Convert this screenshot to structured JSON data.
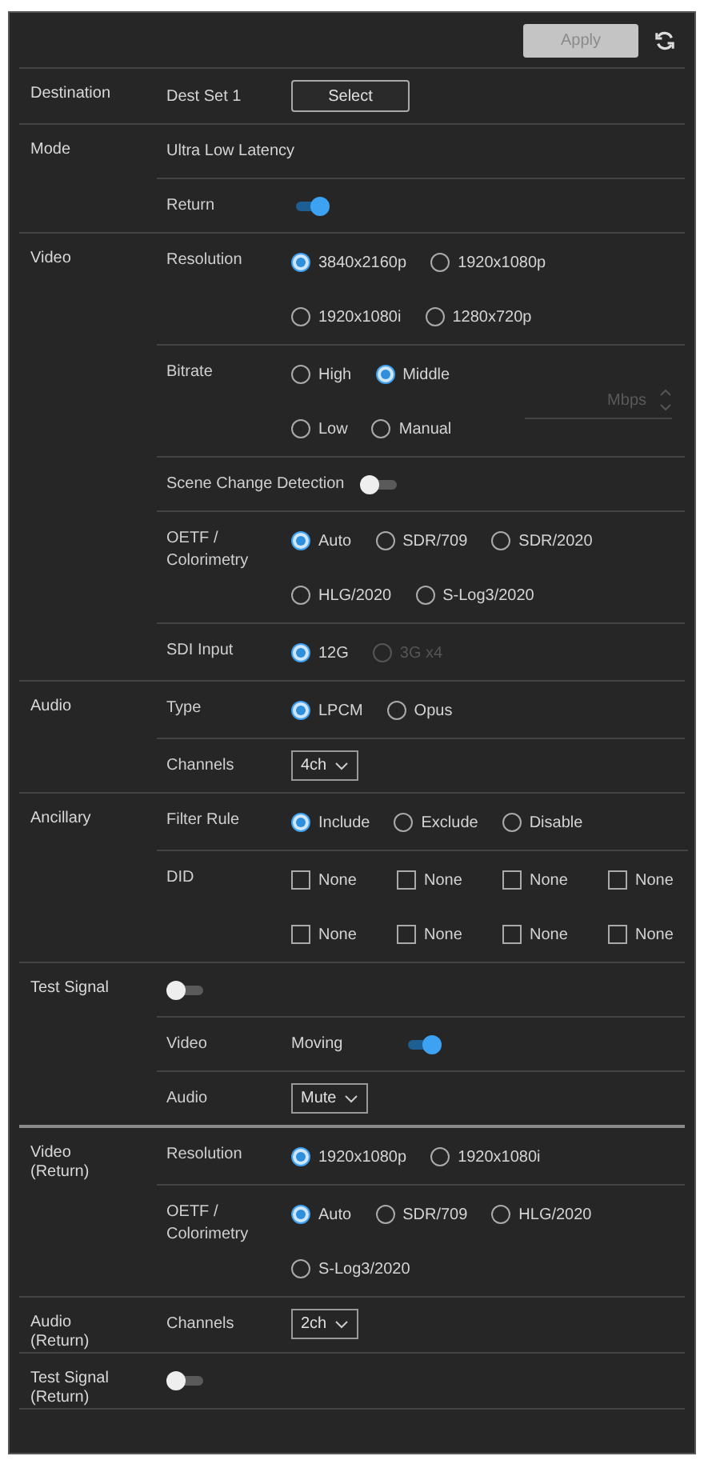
{
  "apply_button": {
    "label": "Apply",
    "disabled": true
  },
  "sections": [
    {
      "label": "Destination",
      "rows": [
        {
          "kind": "button",
          "value": "Dest Set 1",
          "button": "Select"
        }
      ]
    },
    {
      "label": "Mode",
      "rows": [
        {
          "kind": "text",
          "value": "Ultra Low Latency"
        },
        {
          "kind": "toggle",
          "label": "Return",
          "on": true
        }
      ]
    },
    {
      "label": "Video",
      "rows": [
        {
          "kind": "radio",
          "label": "Resolution",
          "lines": [
            [
              {
                "label": "3840x2160p",
                "selected": true,
                "disabled": false
              },
              {
                "label": "1920x1080p",
                "selected": false,
                "disabled": false
              }
            ],
            [
              {
                "label": "1920x1080i",
                "selected": false,
                "disabled": false
              },
              {
                "label": "1280x720p",
                "selected": false,
                "disabled": false
              }
            ]
          ]
        },
        {
          "kind": "radio",
          "label": "Bitrate",
          "lines": [
            [
              {
                "label": "High",
                "selected": false,
                "disabled": false
              },
              {
                "label": "Middle",
                "selected": true,
                "disabled": false
              }
            ],
            [
              {
                "label": "Low",
                "selected": false,
                "disabled": false
              },
              {
                "label": "Manual",
                "selected": false,
                "disabled": false
              }
            ]
          ],
          "field": {
            "placeholder": "Mbps",
            "disabled": true
          }
        },
        {
          "kind": "toggle",
          "label": "Scene Change Detection",
          "on": false
        },
        {
          "kind": "radio",
          "label": "OETF / Colorimetry",
          "lines": [
            [
              {
                "label": "Auto",
                "selected": true,
                "disabled": false
              },
              {
                "label": "SDR/709",
                "selected": false,
                "disabled": false
              },
              {
                "label": "SDR/2020",
                "selected": false,
                "disabled": false
              }
            ],
            [
              {
                "label": "HLG/2020",
                "selected": false,
                "disabled": false
              },
              {
                "label": "S-Log3/2020",
                "selected": false,
                "disabled": false
              }
            ]
          ]
        },
        {
          "kind": "radio",
          "label": "SDI Input",
          "lines": [
            [
              {
                "label": "12G",
                "selected": true,
                "disabled": false
              },
              {
                "label": "3G x4",
                "selected": false,
                "disabled": true
              }
            ]
          ]
        }
      ]
    },
    {
      "label": "Audio",
      "rows": [
        {
          "kind": "radio",
          "label": "Type",
          "lines": [
            [
              {
                "label": "LPCM",
                "selected": true,
                "disabled": false
              },
              {
                "label": "Opus",
                "selected": false,
                "disabled": false
              }
            ]
          ]
        },
        {
          "kind": "select",
          "label": "Channels",
          "value": "4ch"
        }
      ]
    },
    {
      "label": "Ancillary",
      "rows": [
        {
          "kind": "radio",
          "label": "Filter Rule",
          "lines": [
            [
              {
                "label": "Include",
                "selected": true,
                "disabled": false
              },
              {
                "label": "Exclude",
                "selected": false,
                "disabled": false
              },
              {
                "label": "Disable",
                "selected": false,
                "disabled": false
              }
            ]
          ]
        },
        {
          "kind": "checkbox",
          "label": "DID",
          "lines": [
            [
              {
                "label": "None",
                "checked": false
              },
              {
                "label": "None",
                "checked": false
              },
              {
                "label": "None",
                "checked": false
              },
              {
                "label": "None",
                "checked": false
              }
            ],
            [
              {
                "label": "None",
                "checked": false
              },
              {
                "label": "None",
                "checked": false
              },
              {
                "label": "None",
                "checked": false
              },
              {
                "label": "None",
                "checked": false
              }
            ]
          ]
        }
      ]
    },
    {
      "label": "Test Signal",
      "rows": [
        {
          "kind": "toggle",
          "on": false
        },
        {
          "kind": "toggle",
          "label": "Video",
          "text": "Moving",
          "on": true
        },
        {
          "kind": "select",
          "label": "Audio",
          "value": "Mute"
        }
      ]
    },
    {
      "label": "Video (Return)",
      "rows": [
        {
          "kind": "radio",
          "label": "Resolution",
          "lines": [
            [
              {
                "label": "1920x1080p",
                "selected": true,
                "disabled": false
              },
              {
                "label": "1920x1080i",
                "selected": false,
                "disabled": false
              }
            ]
          ]
        },
        {
          "kind": "radio",
          "label": "OETF / Colorimetry",
          "lines": [
            [
              {
                "label": "Auto",
                "selected": true,
                "disabled": false
              },
              {
                "label": "SDR/709",
                "selected": false,
                "disabled": false
              },
              {
                "label": "HLG/2020",
                "selected": false,
                "disabled": false
              }
            ],
            [
              {
                "label": "S-Log3/2020",
                "selected": false,
                "disabled": false
              }
            ]
          ]
        }
      ]
    },
    {
      "label": "Audio (Return)",
      "rows": [
        {
          "kind": "select",
          "label": "Channels",
          "value": "2ch"
        }
      ]
    },
    {
      "label": "Test Signal (Return)",
      "rows": [
        {
          "kind": "toggle",
          "on": false
        }
      ]
    }
  ]
}
